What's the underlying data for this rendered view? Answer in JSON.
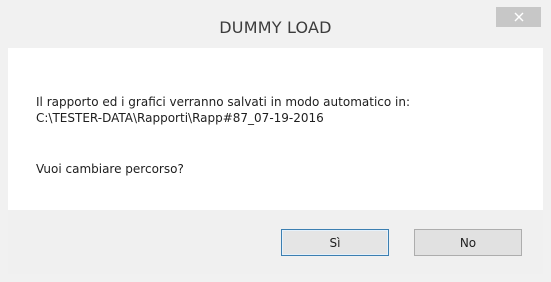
{
  "window": {
    "title": "DUMMY LOAD",
    "close_icon": "close-icon"
  },
  "message": {
    "line1": "Il rapporto ed i grafici verranno salvati in modo automatico in:",
    "line2": "C:\\TESTER-DATA\\Rapporti\\Rapp#87_07-19-2016",
    "question": "Vuoi cambiare percorso?"
  },
  "buttons": {
    "yes_label": "Sì",
    "no_label": "No"
  },
  "colors": {
    "close_button_bg": "#c7c7c7",
    "default_button_border": "#3c7fb1"
  }
}
